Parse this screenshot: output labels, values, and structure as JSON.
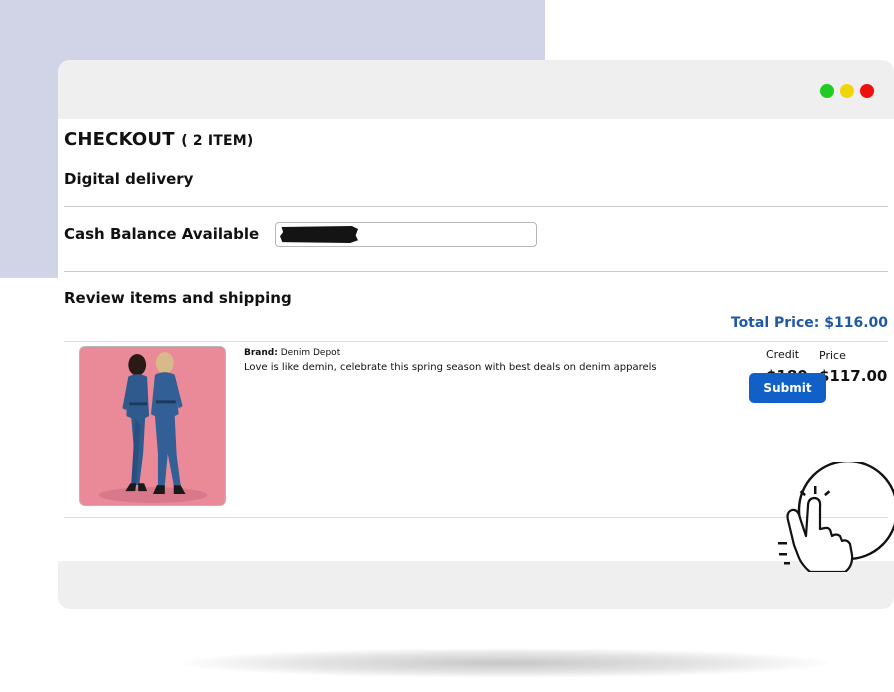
{
  "window": {
    "controls": [
      "green",
      "yellow",
      "red"
    ],
    "colors": {
      "green": "#1fcc22",
      "yellow": "#f2d40a",
      "red": "#ef0f0f"
    }
  },
  "checkout": {
    "title": "CHECKOUT",
    "item_count": "( 2 ITEM)",
    "delivery": "Digital delivery",
    "cash_balance_label": "Cash Balance Available",
    "review_heading": "Review items and shipping",
    "total_label": "Total Price:",
    "total_value": "$116.00"
  },
  "item": {
    "brand_label": "Brand:",
    "brand_name": "Denim Depot",
    "description": "Love is like demin, celebrate this spring season with best deals on denim apparels",
    "credit_label": "Credit",
    "credit_value": "$180",
    "price_label": "Price",
    "price_value": "$117.00"
  },
  "actions": {
    "submit_label": "Submit"
  },
  "colors": {
    "accent": "#1060c8",
    "total_text": "#2158a6",
    "backdrop": "#d0d4e6"
  },
  "icons": [
    "hand-pointer-icon"
  ]
}
